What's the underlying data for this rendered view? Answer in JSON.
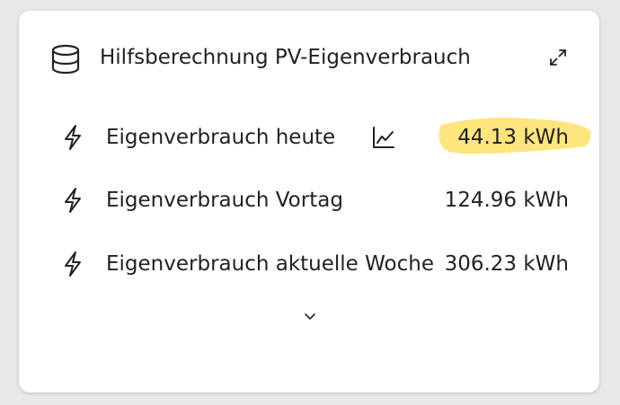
{
  "card": {
    "title": "Hilfsberechnung PV-Eigenverbrauch",
    "header_icon": "database-icon",
    "action_icon": "expand-icon"
  },
  "rows": [
    {
      "icon": "lightning-icon",
      "label": "Eigenverbrauch heute",
      "value": "44.13 kWh",
      "has_chart": true,
      "highlighted": true
    },
    {
      "icon": "lightning-icon",
      "label": "Eigenverbrauch Vortag",
      "value": "124.96 kWh",
      "has_chart": false,
      "highlighted": false
    },
    {
      "icon": "lightning-icon",
      "label": "Eigenverbrauch aktuelle Woche",
      "value": "306.23 kWh",
      "has_chart": false,
      "highlighted": false
    }
  ],
  "footer": {
    "icon": "chevron-down-icon"
  },
  "colors": {
    "highlight": "#ffe066",
    "text": "#222222",
    "background": "#e8e8e8",
    "card": "#ffffff"
  }
}
